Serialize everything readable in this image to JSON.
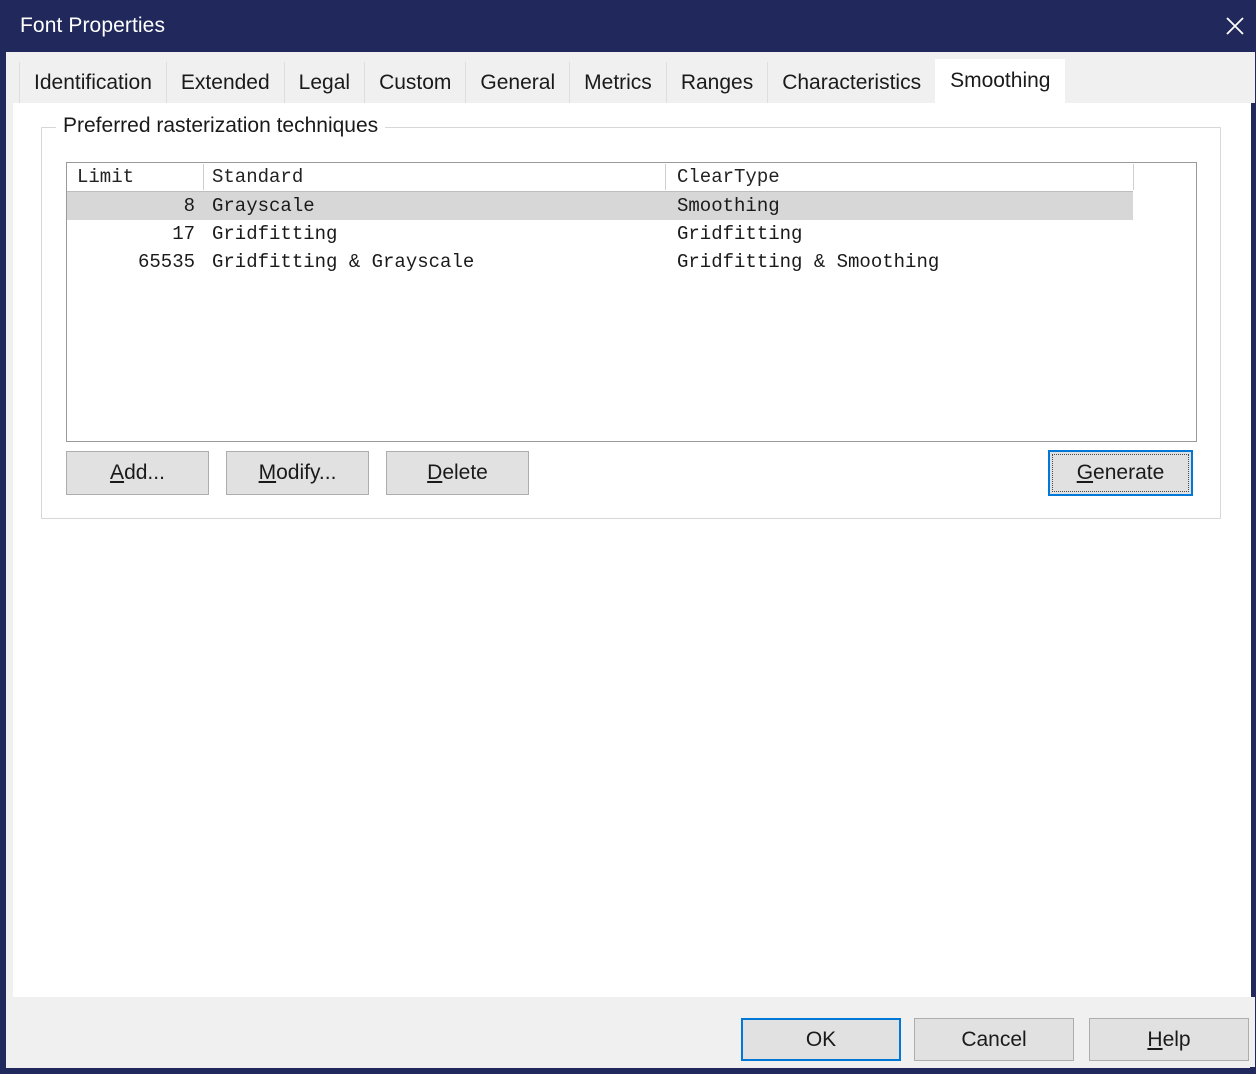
{
  "window": {
    "title": "Font Properties",
    "close_icon": "close-icon",
    "titlebar_color": "#21295c",
    "accent_color": "#0078d7"
  },
  "tabs": [
    {
      "label": "Identification",
      "selected": false
    },
    {
      "label": "Extended",
      "selected": false
    },
    {
      "label": "Legal",
      "selected": false
    },
    {
      "label": "Custom",
      "selected": false
    },
    {
      "label": "General",
      "selected": false
    },
    {
      "label": "Metrics",
      "selected": false
    },
    {
      "label": "Ranges",
      "selected": false
    },
    {
      "label": "Characteristics",
      "selected": false
    },
    {
      "label": "Smoothing",
      "selected": true
    }
  ],
  "groupbox": {
    "label": "Preferred rasterization techniques"
  },
  "listview": {
    "columns": [
      "Limit",
      "Standard",
      "ClearType"
    ],
    "rows": [
      {
        "limit": "8",
        "standard": "Grayscale",
        "cleartype": "Smoothing",
        "selected": true
      },
      {
        "limit": "17",
        "standard": "Gridfitting",
        "cleartype": "Gridfitting",
        "selected": false
      },
      {
        "limit": "65535",
        "standard": "Gridfitting & Grayscale",
        "cleartype": "Gridfitting & Smoothing",
        "selected": false
      }
    ],
    "selection_color": "#d7d7d7"
  },
  "actions": {
    "add": {
      "accel": "A",
      "rest": "dd..."
    },
    "modify": {
      "accel": "M",
      "rest": "odify..."
    },
    "delete": {
      "accel": "D",
      "rest": "elete"
    },
    "generate": {
      "accel": "G",
      "rest": "enerate",
      "focused": true
    }
  },
  "footer": {
    "ok": {
      "label": "OK",
      "default": true
    },
    "cancel": {
      "label": "Cancel"
    },
    "help": {
      "accel": "H",
      "rest": "elp"
    }
  }
}
